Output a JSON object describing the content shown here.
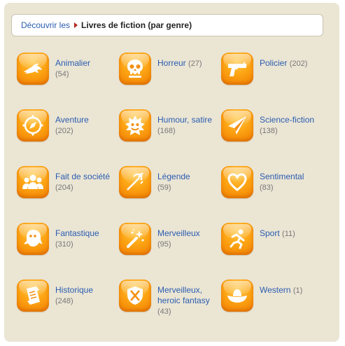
{
  "breadcrumb": {
    "link": "Découvrir les",
    "current": "Livres de fiction (par genre)"
  },
  "categories": [
    {
      "name": "Animalier",
      "count": "(54)",
      "icon": "dolphin-icon"
    },
    {
      "name": "Horreur",
      "count": "(27)",
      "icon": "skull-icon"
    },
    {
      "name": "Policier",
      "count": "(202)",
      "icon": "gun-icon"
    },
    {
      "name": "Aventure",
      "count": "(202)",
      "icon": "compass-icon"
    },
    {
      "name": "Humour, satire",
      "count": "(168)",
      "icon": "jester-icon"
    },
    {
      "name": "Science-fiction",
      "count": "(138)",
      "icon": "spaceship-icon"
    },
    {
      "name": "Fait de société",
      "count": "(204)",
      "icon": "people-icon"
    },
    {
      "name": "Légende",
      "count": "(59)",
      "icon": "trident-icon"
    },
    {
      "name": "Sentimental",
      "count": "(83)",
      "icon": "heart-icon"
    },
    {
      "name": "Fantastique",
      "count": "(310)",
      "icon": "ghost-icon"
    },
    {
      "name": "Merveilleux",
      "count": "(95)",
      "icon": "magic-wand-icon"
    },
    {
      "name": "Sport",
      "count": "(11)",
      "icon": "runner-icon"
    },
    {
      "name": "Historique",
      "count": "(248)",
      "icon": "scroll-icon"
    },
    {
      "name": "Merveilleux, heroic fantasy",
      "count": "(43)",
      "icon": "shield-swords-icon"
    },
    {
      "name": "Western",
      "count": "(1)",
      "icon": "cowboy-hat-icon"
    }
  ],
  "colors": {
    "panel": "#ebe5d4",
    "link": "#2a5db0",
    "tile": "#fda514"
  }
}
